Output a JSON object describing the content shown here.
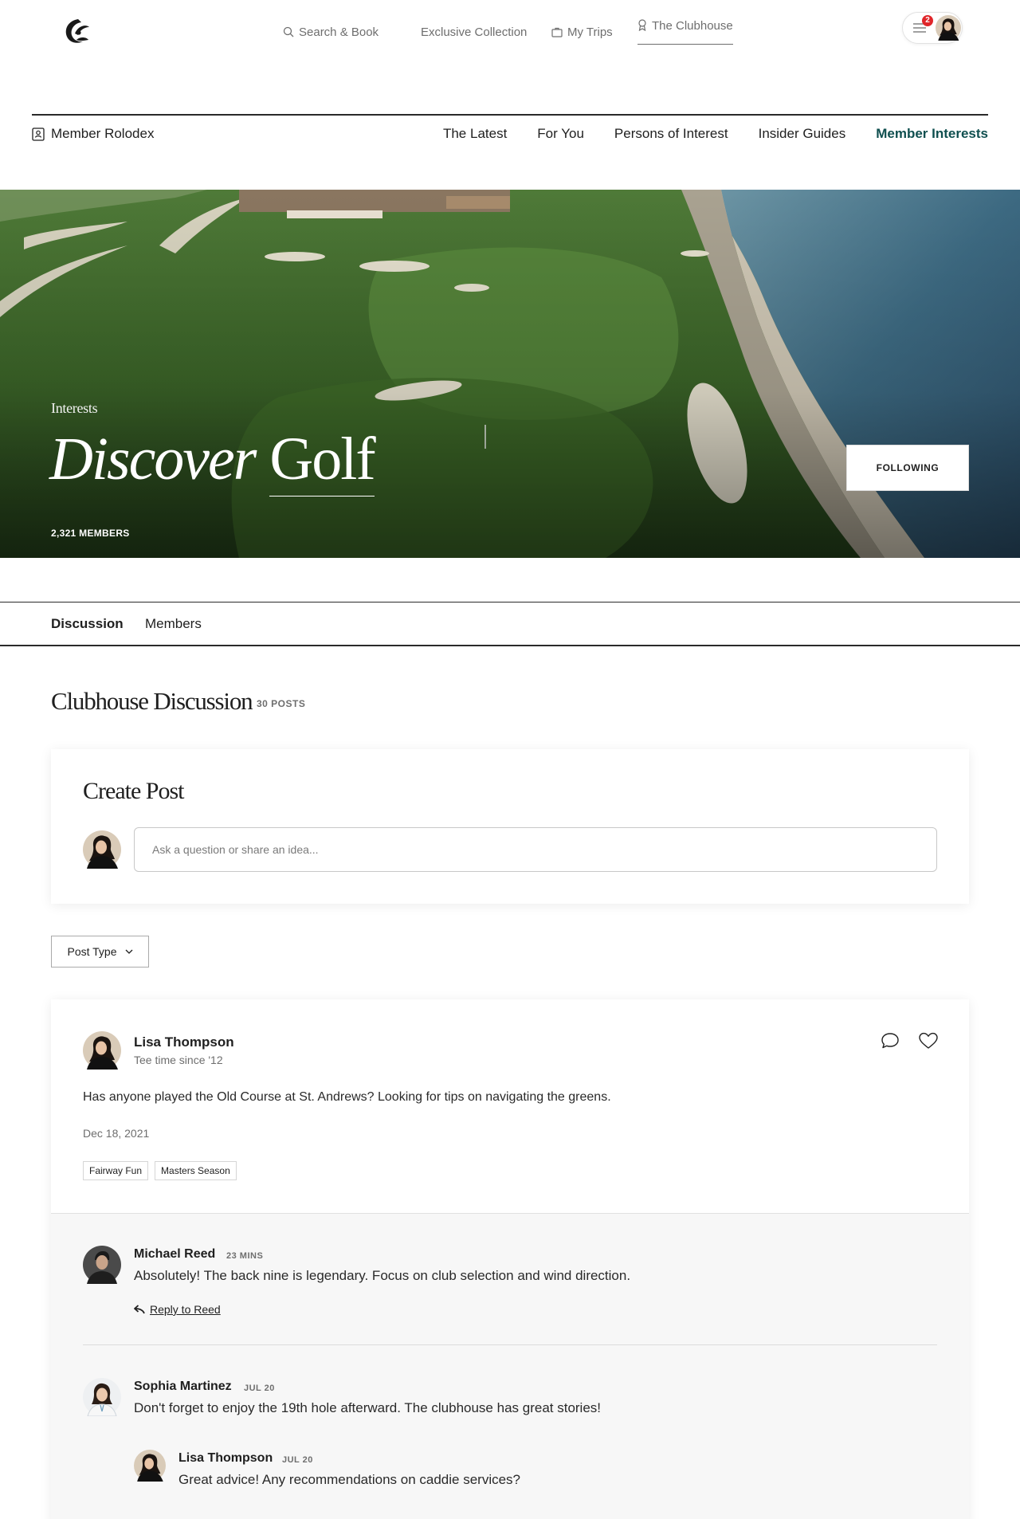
{
  "nav": {
    "search_label": "Search & Book",
    "collection_label": "Exclusive Collection",
    "trips_label": "My Trips",
    "clubhouse_label": "The Clubhouse",
    "notification_count": "2"
  },
  "subnav": {
    "rolodex_label": "Member Rolodex",
    "links": [
      "The Latest",
      "For You",
      "Persons of Interest",
      "Insider Guides",
      "Member Interests"
    ],
    "active_link": "Member Interests"
  },
  "hero": {
    "eyebrow": "Interests",
    "title_word_1": "Discover",
    "title_word_2": "Golf",
    "members": "2,321 MEMBERS",
    "follow_button": "FOLLOWING"
  },
  "tabs": [
    "Discussion",
    "Members"
  ],
  "discussion": {
    "title": "Clubhouse Discussion",
    "count": "30 POSTS"
  },
  "create_post": {
    "title": "Create Post",
    "placeholder": "Ask a question or share an idea..."
  },
  "filter": {
    "label": "Post Type"
  },
  "post": {
    "author": "Lisa Thompson",
    "tagline": "Tee time since '12",
    "body": "Has anyone played the Old Course at St. Andrews? Looking for tips on navigating the greens.",
    "date": "Dec 18, 2021",
    "tags": [
      "Fairway Fun",
      "Masters Season"
    ]
  },
  "replies": [
    {
      "name": "Michael Reed",
      "time": "23 MINS",
      "text": "Absolutely! The back nine is legendary. Focus on club selection and wind direction.",
      "reply_label": "Reply to Reed"
    },
    {
      "name": "Sophia Martinez",
      "time": "JUL 20",
      "text": "Don't forget to enjoy the 19th hole afterward. The clubhouse has great stories!"
    },
    {
      "name": "Lisa Thompson",
      "time": "JUL 20",
      "text": "Great advice! Any recommendations on caddie services?"
    }
  ],
  "colors": {
    "accent": "#0f4f4f",
    "badge": "#e0262a",
    "text": "#1f1f1f",
    "muted": "#6e6e6e"
  }
}
